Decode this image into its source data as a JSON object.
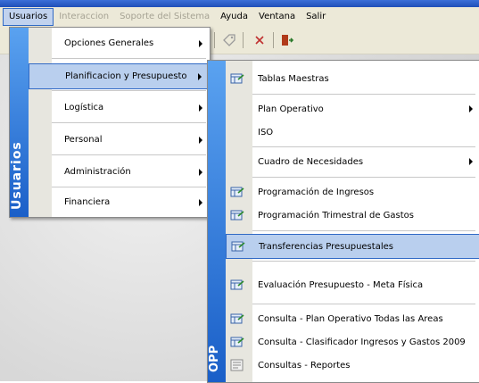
{
  "menubar": {
    "items": [
      "Usuarios",
      "Interaccion",
      "Soporte del Sistema",
      "Ayuda",
      "Ventana",
      "Salir"
    ]
  },
  "menu1": {
    "band_label": "Usuarios",
    "items": [
      {
        "label": "Opciones Generales",
        "submenu": true
      },
      {
        "label": "Planificacion y Presupuesto",
        "submenu": true,
        "active": true
      },
      {
        "label": "Logística",
        "submenu": true
      },
      {
        "label": "Personal",
        "submenu": true
      },
      {
        "label": "Administración",
        "submenu": true
      },
      {
        "label": "Financiera",
        "submenu": true
      }
    ]
  },
  "menu2": {
    "band_label": "OPP",
    "items": [
      {
        "label": "Tablas Maestras",
        "icon": "grid-form-icon"
      },
      {
        "label": "Plan Operativo",
        "submenu": true
      },
      {
        "label": "ISO"
      },
      {
        "label": "Cuadro de Necesidades",
        "submenu": true
      },
      {
        "label": "Programación de Ingresos",
        "icon": "grid-form-icon"
      },
      {
        "label": "Programación Trimestral de Gastos",
        "icon": "grid-form-icon"
      },
      {
        "label": "Transferencias Presupuestales",
        "icon": "grid-form-icon",
        "active": true
      },
      {
        "label": "Evaluación Presupuesto - Meta Física",
        "icon": "grid-form-icon"
      },
      {
        "label": "Consulta - Plan Operativo Todas las Areas",
        "icon": "grid-form-icon"
      },
      {
        "label": "Consulta - Clasificador Ingresos y Gastos 2009",
        "icon": "grid-form-icon"
      },
      {
        "label": "Consultas - Reportes",
        "icon": "report-icon"
      }
    ]
  },
  "colors": {
    "accent": "#316ac5",
    "highlight": "#b9cfee",
    "band": "#1a5fc8",
    "menubar": "#ece9d8"
  }
}
